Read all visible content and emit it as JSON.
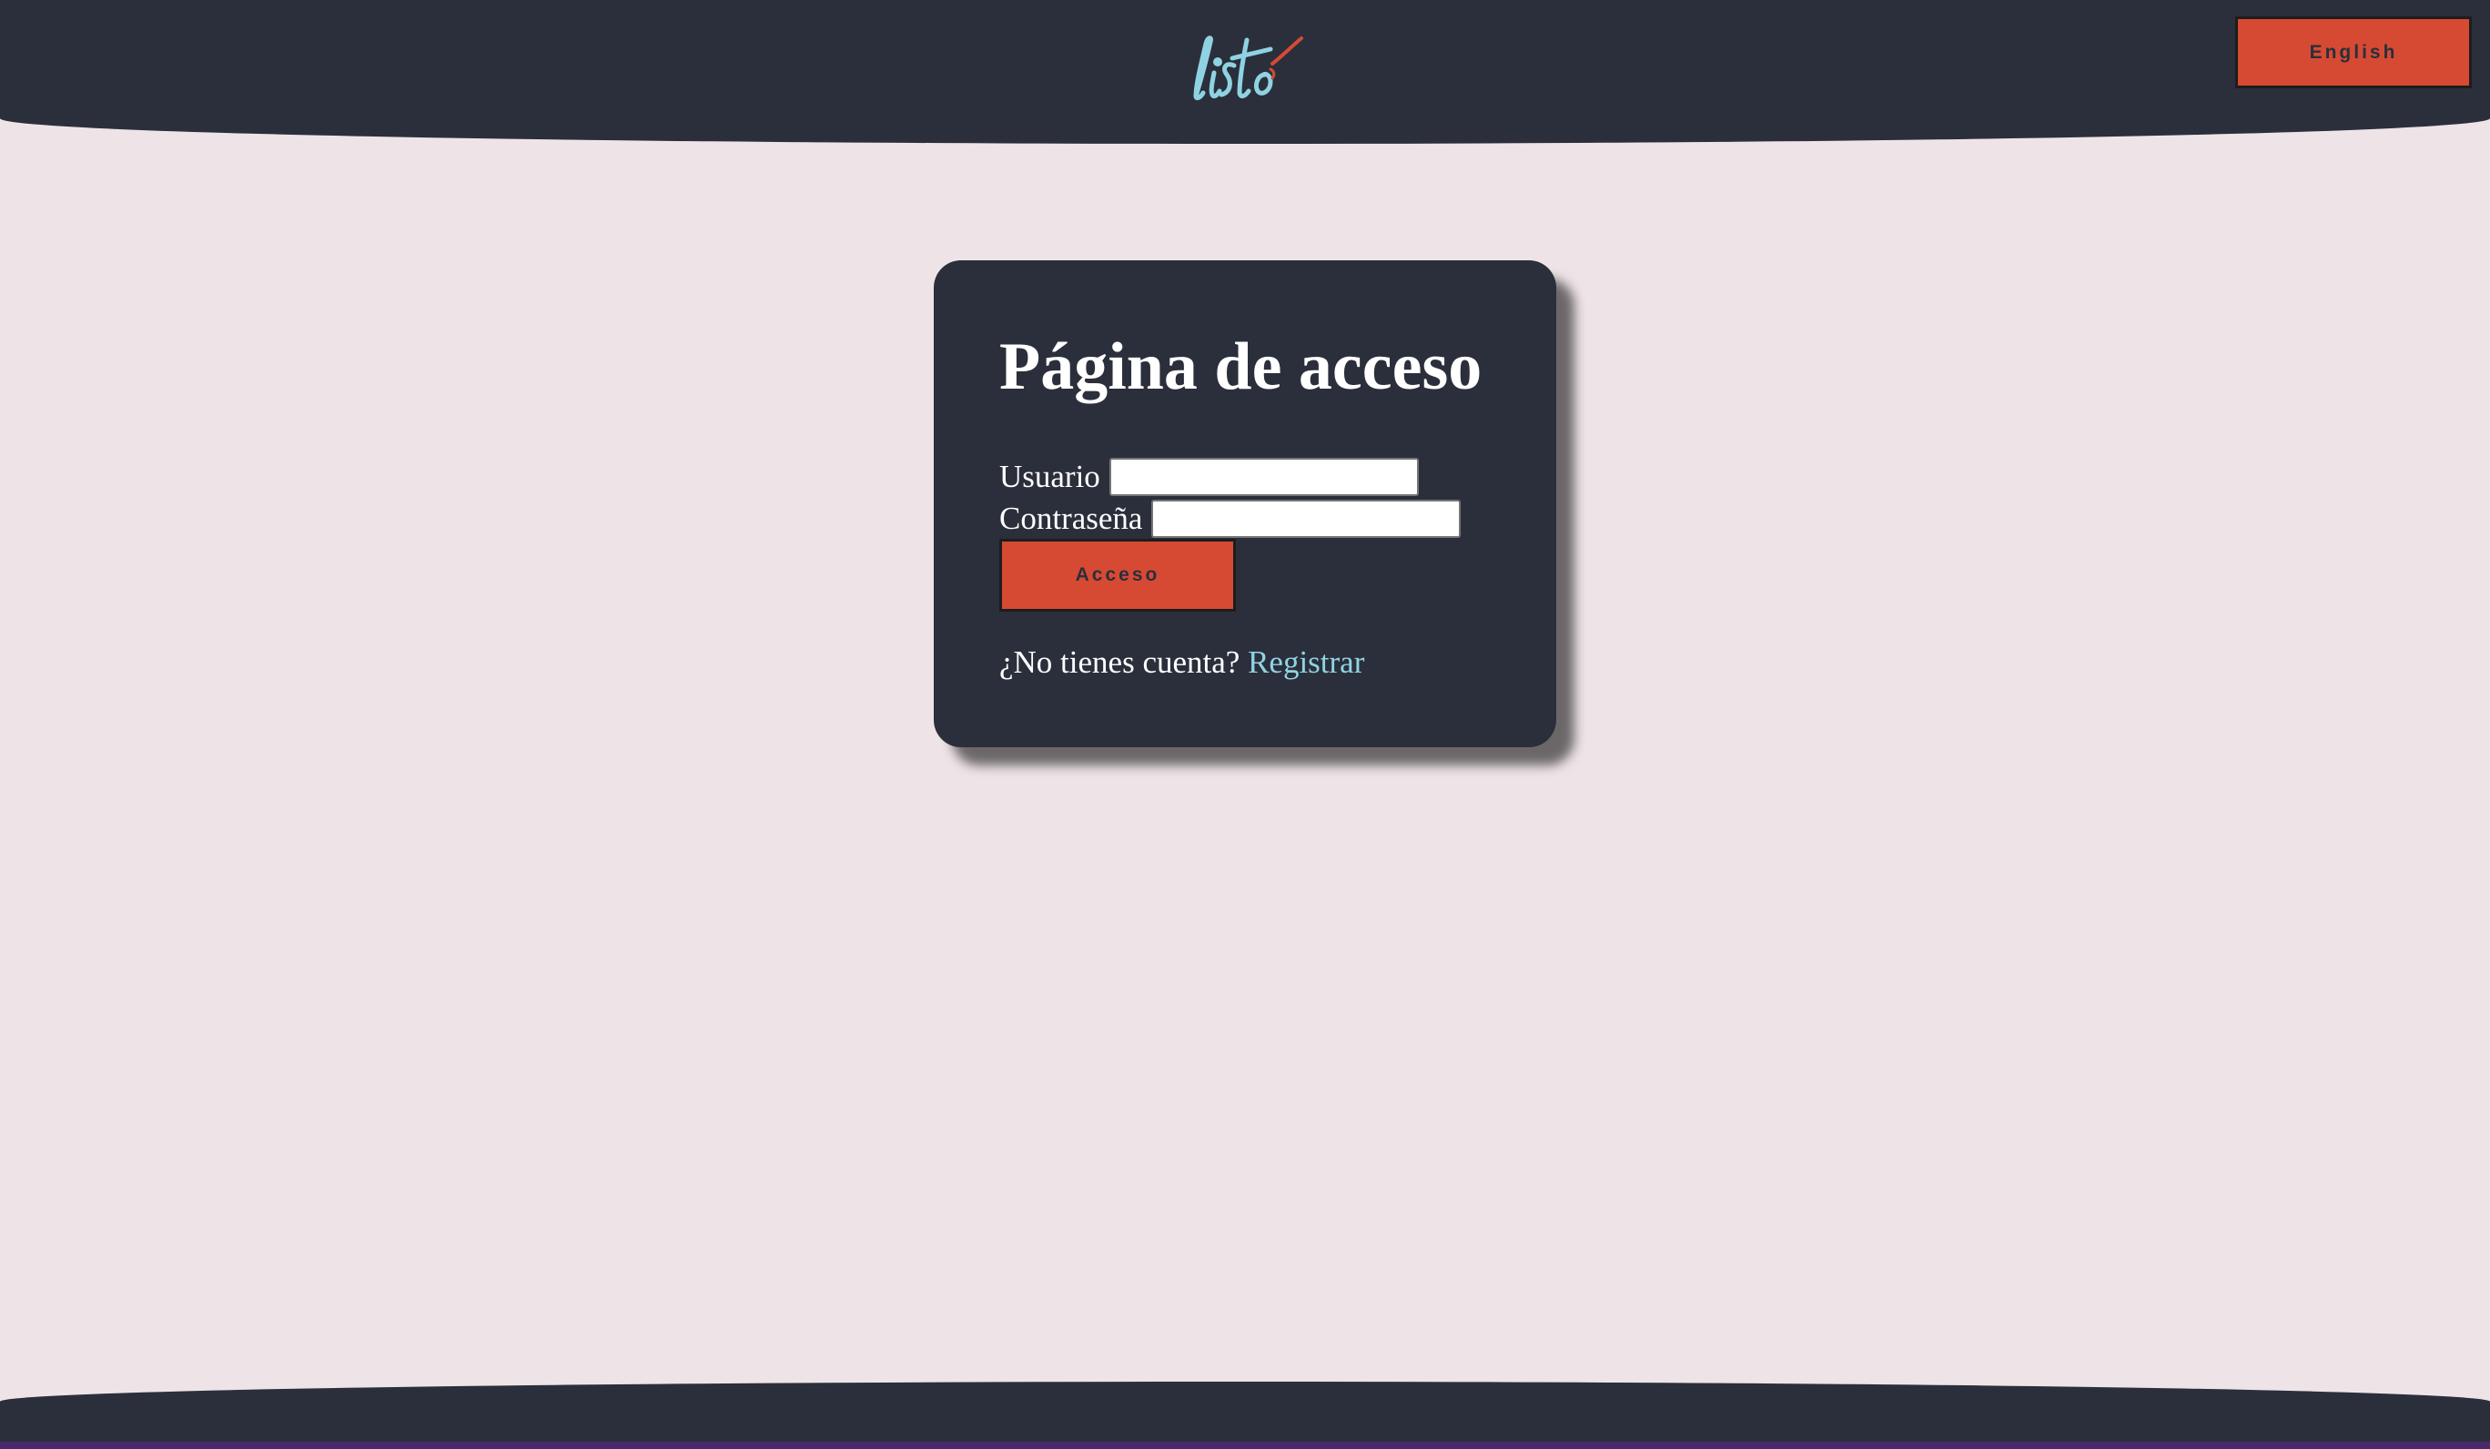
{
  "header": {
    "logo_text": "listo",
    "language_button": "English"
  },
  "login": {
    "title": "Página de acceso",
    "username_label": "Usuario",
    "username_value": "",
    "password_label": "Contraseña",
    "password_value": "",
    "submit_label": "Acceso",
    "no_account_text": "¿No tienes cuenta?",
    "register_link": "Registrar"
  },
  "colors": {
    "background": "#eee4e7",
    "dark": "#2b2f3b",
    "accent": "#d64a34",
    "link": "#8fd3e3",
    "logo": "#8fd3e3",
    "logo_check": "#d64a34"
  }
}
